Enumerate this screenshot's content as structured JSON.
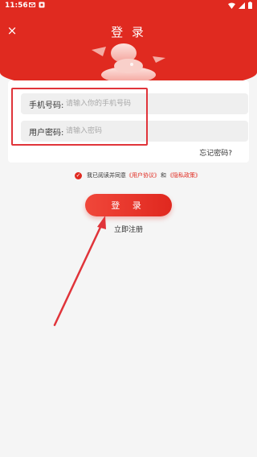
{
  "status_bar": {
    "time": "11:56"
  },
  "header": {
    "title": "登 录",
    "close_symbol": "×"
  },
  "form": {
    "phone": {
      "label": "手机号码:",
      "placeholder": "请输入你的手机号码",
      "value": ""
    },
    "password": {
      "label": "用户密码:",
      "placeholder": "请输入密码",
      "value": ""
    },
    "forgot_label": "忘记密码?"
  },
  "agreement": {
    "checked": true,
    "prefix": "我已阅读并同意",
    "user_agreement": "《用户协议》",
    "and": "和",
    "privacy_policy": "《隐私政策》"
  },
  "login_button": "登 录",
  "register_label": "立即注册",
  "colors": {
    "brand_red": "#e02a20",
    "annotation_red": "#e0343a",
    "background": "#f5f5f5"
  }
}
